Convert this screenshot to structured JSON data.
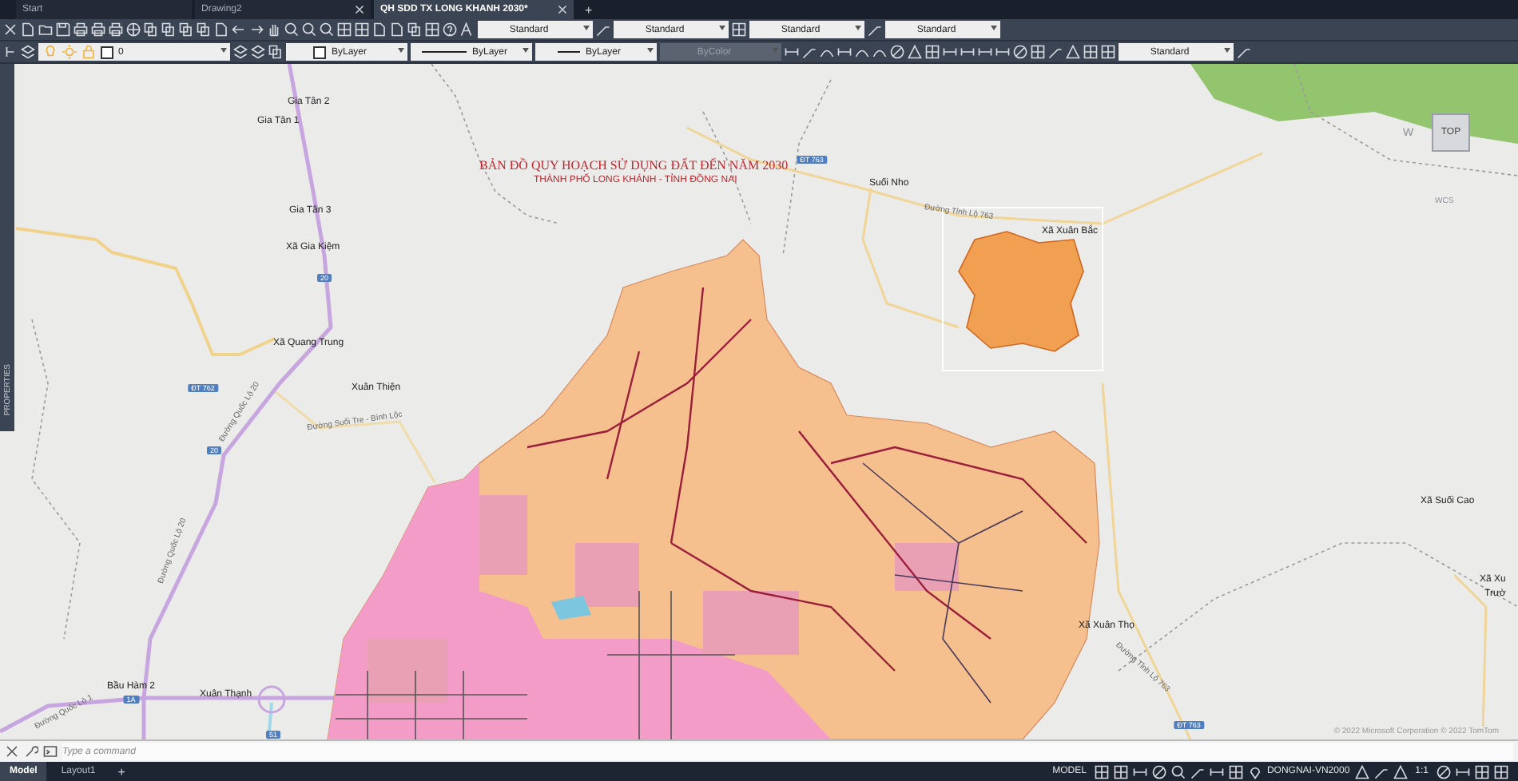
{
  "tabs": [
    {
      "label": "Start",
      "selected": false
    },
    {
      "label": "Drawing2",
      "selected": false
    },
    {
      "label": "QH SDD TX LONG KHANH 2030*",
      "selected": true
    }
  ],
  "new_tab": "+",
  "toolbar_1": {
    "styles": [
      "Standard",
      "Standard",
      "Standard",
      "Standard"
    ]
  },
  "toolbar_2": {
    "layer": "0",
    "color_control": "ByLayer",
    "linetype": "ByLayer",
    "lineweight": "ByLayer",
    "plot_style": {
      "value": "ByColor",
      "disabled": true
    },
    "dim_style": "Standard"
  },
  "palette": {
    "label": "PROPERTIES"
  },
  "viewcube": {
    "side": "W",
    "face": "TOP",
    "ucs": "WCS"
  },
  "map": {
    "title": "BẢN ĐỒ QUY HOẠCH SỬ DỤNG ĐẤT ĐẾN NĂM 2030",
    "subtitle": "THÀNH PHỐ LONG KHÁNH - TỈNH ĐỒNG NAI",
    "place_labels": [
      "Gia Tân 2",
      "Gia Tân 1",
      "Gia Tân 3",
      "Xã Gia Kiệm",
      "Xã Quang Trung",
      "Xuân Thiện",
      "Bầu Hàm 2",
      "Xuân Thạnh",
      "Suối Nho",
      "Xã Xuân Bắc",
      "Xã Suối Cao",
      "Xã Xuân Thọ",
      "Xã Xu",
      "Trườ"
    ],
    "road_labels": [
      "Đường Quốc Lộ 20",
      "Đường Quốc Lộ 20",
      "Đường Quốc Lộ 1",
      "Đường Suối Tre - Bình Lộc",
      "Đường Tỉnh Lộ 763",
      "Đường Tỉnh Lộ 763"
    ],
    "road_shields": [
      "20",
      "ĐT 762",
      "20",
      "1A",
      "51",
      "ĐT 763",
      "ĐT 763"
    ],
    "attribution": "© 2022 Microsoft Corporation © 2022 TomTom"
  },
  "command_line": {
    "placeholder": "Type a command"
  },
  "layout_tabs": [
    {
      "label": "Model",
      "selected": true
    },
    {
      "label": "Layout1",
      "selected": false
    }
  ],
  "new_layout": "+",
  "status_bar": {
    "space": "MODEL",
    "coordinate_system": "DONGNAI-VN2000",
    "scale": "1:1"
  }
}
